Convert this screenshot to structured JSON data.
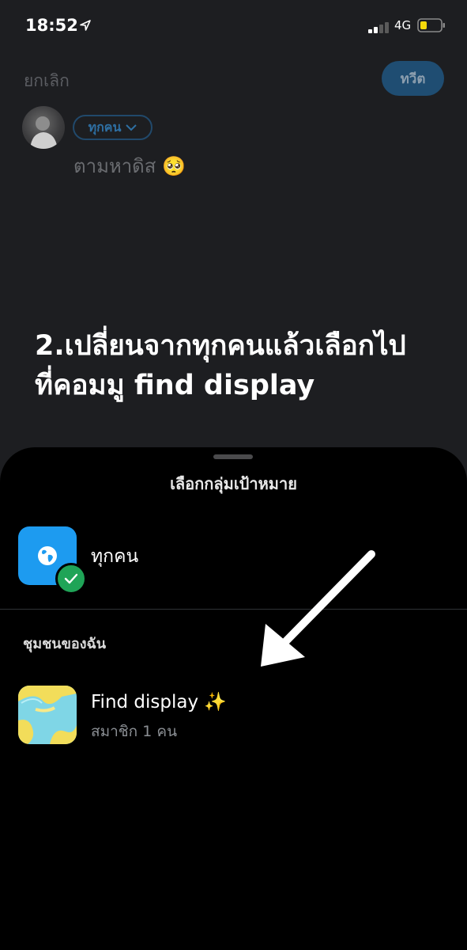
{
  "status_bar": {
    "time": "18:52",
    "network": "4G"
  },
  "composer": {
    "cancel_label": "ยกเลิก",
    "tweet_label": "ทวีต",
    "audience_label": "ทุกคน",
    "draft_text": "ตามหาดิส 🥺"
  },
  "caption": {
    "line1": "2.เปลี่ยนจากทุกคนแล้วเลือกไป",
    "line2": "ที่คอมมู find display"
  },
  "sheet": {
    "title": "เลือกกลุ่มเป้าหมาย",
    "everyone_label": "ทุกคน",
    "section_label": "ชุมชนของฉัน",
    "community": {
      "name": "Find display ✨",
      "members": "สมาชิก 1 คน"
    }
  },
  "colors": {
    "accent": "#1d9bf0",
    "check": "#1fa457",
    "sheet_bg": "#000000",
    "bg": "#1d1e21"
  }
}
